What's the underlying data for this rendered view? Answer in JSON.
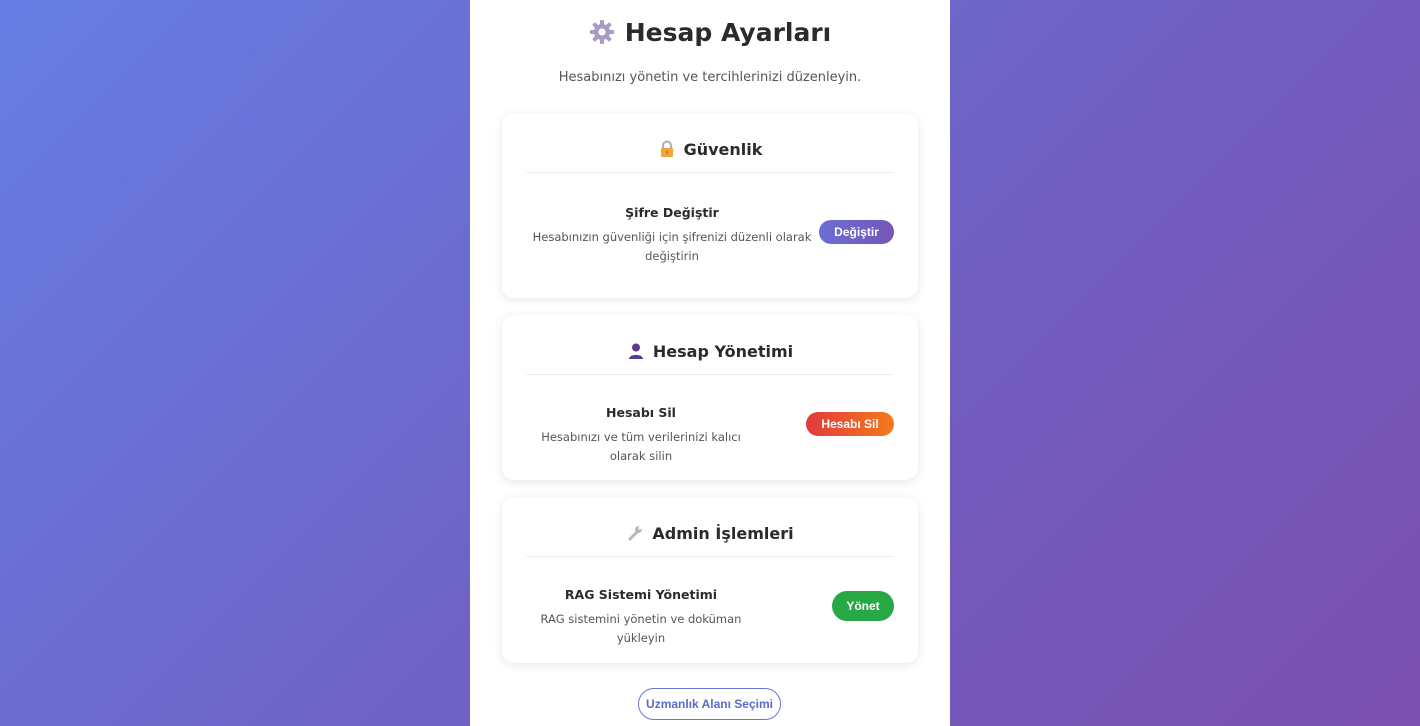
{
  "header": {
    "title": "Hesap Ayarları",
    "title_icon": "gear-icon",
    "subtitle": "Hesabınızı yönetin ve tercihlerinizi düzenleyin."
  },
  "sections": [
    {
      "title": "Güvenlik",
      "icon": "lock-icon",
      "item": {
        "title": "Şifre Değiştir",
        "description": "Hesabınızın güvenliği için şifrenizi düzenli olarak değiştirin",
        "button": "Değiştir"
      }
    },
    {
      "title": "Hesap Yönetimi",
      "icon": "user-icon",
      "item": {
        "title": "Hesabı Sil",
        "description": "Hesabınızı ve tüm verilerinizi kalıcı olarak silin",
        "button": "Hesabı Sil"
      }
    },
    {
      "title": "Admin İşlemleri",
      "icon": "wrench-icon",
      "item": {
        "title": "RAG Sistemi Yönetimi",
        "description": "RAG sistemini yönetin ve doküman yükleyin",
        "button": "Yönet"
      }
    }
  ],
  "footer": {
    "button": "Uzmanlık Alanı Seçimi"
  },
  "colors": {
    "primary": "#667eea",
    "danger": "#e53e3e",
    "success": "#28a745"
  }
}
